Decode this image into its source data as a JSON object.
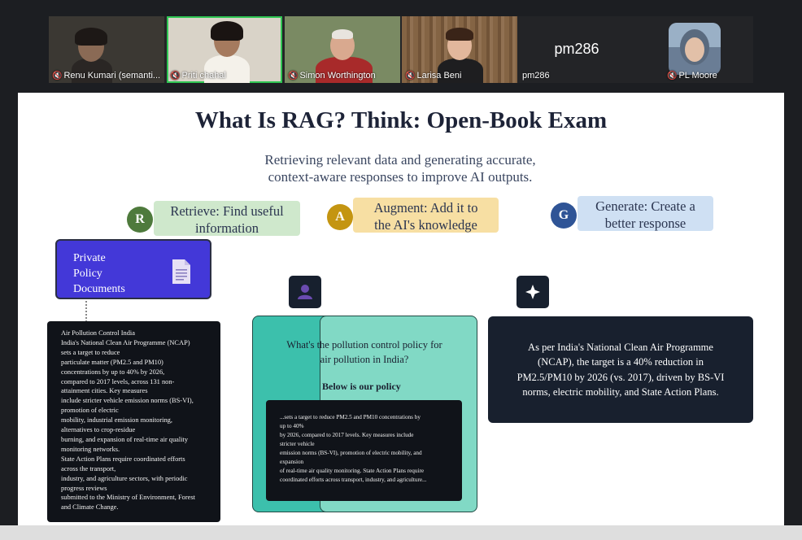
{
  "participants": [
    {
      "name": "Renu Kumari (semanti...",
      "muted": true
    },
    {
      "name": "Priti chahal",
      "muted": true,
      "active": true
    },
    {
      "name": "Simon Worthington",
      "muted": true
    },
    {
      "name": "Larisa Beni",
      "muted": true
    },
    {
      "name": "pm286",
      "muted": false,
      "placeholder": "pm286"
    },
    {
      "name": "PL Moore",
      "muted": true
    }
  ],
  "slide": {
    "title": "What Is RAG? Think: Open-Book Exam",
    "subtitle_line1": "Retrieving relevant data and generating accurate,",
    "subtitle_line2": "context-aware responses to improve AI outputs.",
    "steps": [
      {
        "letter": "R",
        "line1": "Retrieve: Find useful",
        "line2": "information",
        "circle_color": "#4e7a3c",
        "label_bg": "#cfe8cc"
      },
      {
        "letter": "A",
        "line1": "Augment: Add it to",
        "line2": "the AI's knowledge",
        "circle_color": "#c49511",
        "label_bg": "#f7dfa3"
      },
      {
        "letter": "G",
        "line1": "Generate: Create a",
        "line2": "better response",
        "circle_color": "#2f5496",
        "label_bg": "#cfe0f3"
      }
    ],
    "policy_docs": {
      "line1": "Private",
      "line2": "Policy",
      "line3": "Documents",
      "icon": "document-icon"
    },
    "left_doc_lines": [
      "Air Pollution Control India",
      "India's National Clean Air Programme (NCAP)",
      "sets a target to reduce",
      "particulate matter (PM2.5 and PM10)",
      "concentrations by up to 40% by 2026,",
      "compared to 2017 levels, across 131 non-",
      "attainment cities. Key measures",
      "include stricter vehicle emission norms (BS-VI),",
      "promotion of electric",
      "mobility, industrial emission monitoring,",
      "alternatives to crop-residue",
      "burning, and expansion of real-time air quality",
      "monitoring networks.",
      "State Action Plans require coordinated efforts",
      "across the transport,",
      "industry, and agriculture sectors, with periodic",
      "progress reviews",
      "submitted to the Ministry of Environment, Forest",
      "and Climate Change."
    ],
    "user_icon": "user-icon",
    "sparkle_icon": "sparkle-icon",
    "question_line1": "What's the pollution control policy for",
    "question_line2": "air pollution in India?",
    "below_policy": "Below is our policy",
    "inner_doc_lines": [
      "...sets a target to reduce PM2.5 and PM10 concentrations by",
      "up to 40%",
      "by 2026, compared to 2017 levels. Key measures include",
      "stricter vehicle",
      "emission norms (BS-VI), promotion of electric mobility, and",
      "expansion",
      "of real-time air quality monitoring. State Action Plans require",
      "coordinated efforts across transport, industry, and agriculture..."
    ],
    "answer_line1": "As per India's National Clean Air Programme",
    "answer_line2": "(NCAP), the target is a 40% reduction in",
    "answer_line3": "PM2.5/PM10 by 2026 (vs. 2017), driven by BS-VI",
    "answer_line4": "norms, electric mobility, and State Action Plans."
  }
}
